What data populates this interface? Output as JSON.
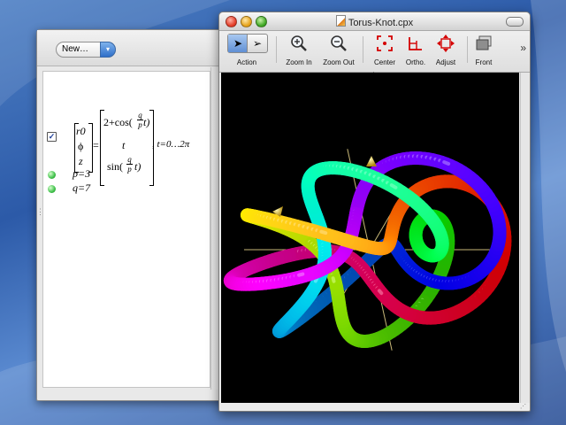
{
  "document": {
    "new_button": "New…",
    "row_checked": "✓",
    "equation": {
      "r0": "r0",
      "phi": "ϕ",
      "z": "z",
      "eq": "=",
      "top": "2+cos(",
      "middle": "t",
      "bottom": "sin(",
      "frac_num": "q",
      "frac_den": "p",
      "close_t": "t)",
      "range": ", t=0…2π"
    },
    "params": [
      {
        "label": "p=3"
      },
      {
        "label": "q=7"
      }
    ]
  },
  "plot_window": {
    "title": "Torus-Knot.cpx",
    "toolbar": [
      {
        "label": "Action",
        "icon": "action-arrows-icon"
      },
      {
        "label": "Zoom In",
        "icon": "zoom-in-icon"
      },
      {
        "label": "Zoom Out",
        "icon": "zoom-out-icon"
      },
      {
        "label": "Center",
        "icon": "center-icon"
      },
      {
        "label": "Ortho.",
        "icon": "ortho-icon"
      },
      {
        "label": "Adjust",
        "icon": "adjust-icon"
      },
      {
        "label": "Front",
        "icon": "front-icon"
      }
    ],
    "more": "»",
    "accent_colors": [
      "#ff0000",
      "#ff7f00",
      "#ffff00",
      "#00ff00",
      "#00ffff",
      "#0080ff",
      "#8000ff",
      "#ff00ff"
    ]
  }
}
